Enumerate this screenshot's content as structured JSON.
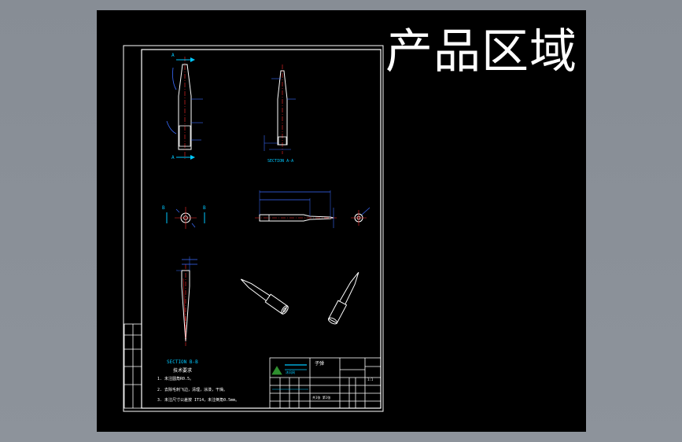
{
  "watermark": "产品区域",
  "views": {
    "section_aa": "SECTION A-A",
    "section_bb": "SECTION B-B",
    "section_letter_a": "A",
    "section_letter_b": "B"
  },
  "notes": {
    "heading": "技术要求",
    "items": [
      "1. 未注圆角R0.5。",
      "2. 去除毛刺飞边，清理，涂漆，干燥。",
      "3. 未注尺寸公差按 IT14，未注倒角0.5mm。"
    ]
  },
  "title_block": {
    "brand": "沐风网",
    "part_name": "子弹",
    "sheet": "共1张 第1张",
    "scale": "1:1"
  },
  "colors": {
    "frame": "#ffffff",
    "dimension": "#3a6cff",
    "text": "#00c8ff",
    "part": "#ffffff",
    "accent": "#ff2a2a",
    "canvas": "#000000"
  }
}
